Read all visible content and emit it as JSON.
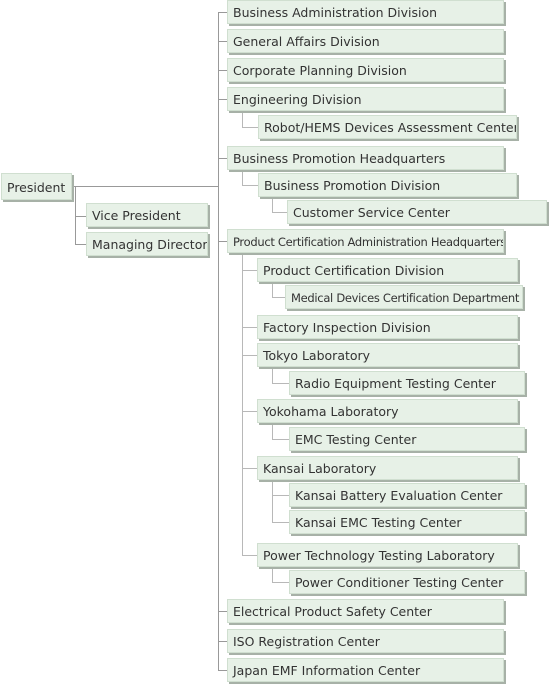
{
  "president": "President",
  "vice_president": "Vice President",
  "managing_director": "Managing Director",
  "units": {
    "business_admin": "Business Administration Division",
    "general_affairs": "General Affairs Division",
    "corporate_planning": "Corporate Planning Division",
    "engineering": "Engineering Division",
    "robot_hems": "Robot/HEMS Devices Assessment Center",
    "business_promotion_hq": "Business Promotion Headquarters",
    "business_promotion_div": "Business Promotion Division",
    "customer_service": "Customer Service Center",
    "pca_hq": "Product Certification Administration Headquarters",
    "product_cert_div": "Product Certification Division",
    "medical_devices": "Medical Devices Certification Department",
    "factory_inspection": "Factory Inspection Division",
    "tokyo_lab": "Tokyo Laboratory",
    "radio_equipment": "Radio Equipment Testing Center",
    "yokohama_lab": "Yokohama Laboratory",
    "emc_testing": "EMC Testing Center",
    "kansai_lab": "Kansai Laboratory",
    "kansai_battery": "Kansai Battery Evaluation Center",
    "kansai_emc": "Kansai EMC Testing Center",
    "power_tech_lab": "Power Technology Testing Laboratory",
    "power_conditioner": "Power Conditioner Testing Center",
    "electrical_safety": "Electrical Product Safety Center",
    "iso_registration": "ISO Registration Center",
    "japan_emf": "Japan EMF Information Center"
  },
  "colors": {
    "box_fill": "#e7f1e7",
    "box_shadow": "#a7b1a7",
    "line": "#999999"
  }
}
